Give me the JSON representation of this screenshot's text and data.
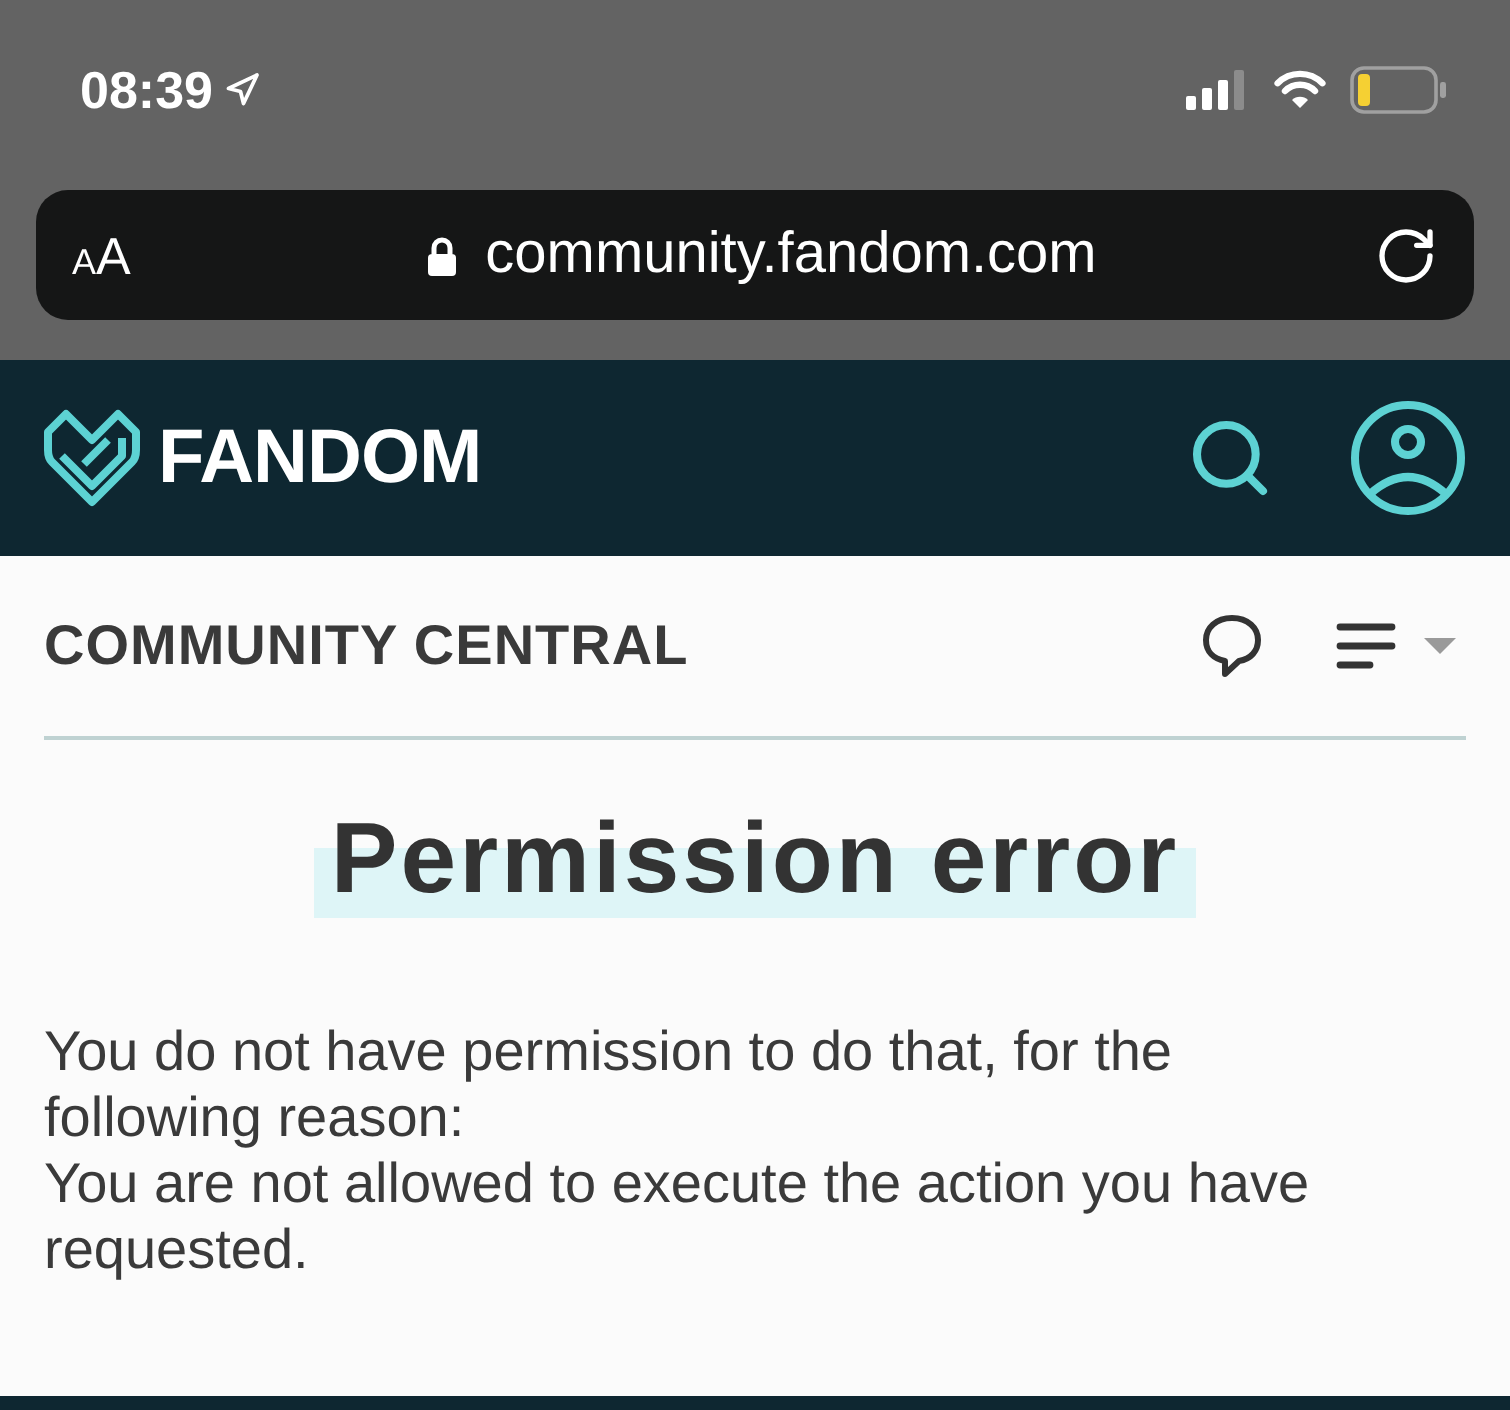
{
  "status_bar": {
    "time": "08:39"
  },
  "address_bar": {
    "text_size_label": "AA",
    "url": "community.fandom.com"
  },
  "site_header": {
    "logo_text": "FANDOM"
  },
  "wiki_bar": {
    "name": "COMMUNITY CENTRAL"
  },
  "page": {
    "title": "Permission error",
    "message_lines": [
      "You do not have permission to do that, for the following reason:",
      "You are not allowed to execute the action you have requested."
    ]
  }
}
